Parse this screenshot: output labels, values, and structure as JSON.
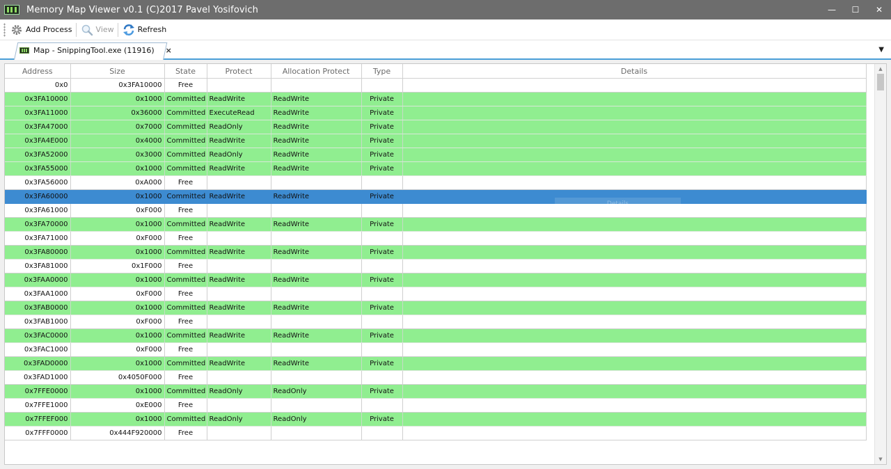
{
  "window": {
    "title": "Memory Map Viewer v0.1 (C)2017 Pavel Yosifovich",
    "minimize": "—",
    "maximize": "☐",
    "close": "✕"
  },
  "toolbar": {
    "add_process": "Add Process",
    "view": "View",
    "refresh": "Refresh"
  },
  "tab": {
    "label": "Map - SnippingTool.exe (11916)",
    "close": "×",
    "dropdown": "▼"
  },
  "grid": {
    "columns": [
      "Address",
      "Size",
      "State",
      "Protect",
      "Allocation Protect",
      "Type",
      "Details"
    ],
    "selected_details_ghost": "Details",
    "rows": [
      {
        "address": "0x0",
        "size": "0x3FA10000",
        "state": "Free",
        "protect": "",
        "alloc": "",
        "type": ""
      },
      {
        "address": "0x3FA10000",
        "size": "0x1000",
        "state": "Committed",
        "protect": "ReadWrite",
        "alloc": "ReadWrite",
        "type": "Private"
      },
      {
        "address": "0x3FA11000",
        "size": "0x36000",
        "state": "Committed",
        "protect": "ExecuteRead",
        "alloc": "ReadWrite",
        "type": "Private"
      },
      {
        "address": "0x3FA47000",
        "size": "0x7000",
        "state": "Committed",
        "protect": "ReadOnly",
        "alloc": "ReadWrite",
        "type": "Private"
      },
      {
        "address": "0x3FA4E000",
        "size": "0x4000",
        "state": "Committed",
        "protect": "ReadWrite",
        "alloc": "ReadWrite",
        "type": "Private"
      },
      {
        "address": "0x3FA52000",
        "size": "0x3000",
        "state": "Committed",
        "protect": "ReadOnly",
        "alloc": "ReadWrite",
        "type": "Private"
      },
      {
        "address": "0x3FA55000",
        "size": "0x1000",
        "state": "Committed",
        "protect": "ReadWrite",
        "alloc": "ReadWrite",
        "type": "Private"
      },
      {
        "address": "0x3FA56000",
        "size": "0xA000",
        "state": "Free",
        "protect": "",
        "alloc": "",
        "type": ""
      },
      {
        "address": "0x3FA60000",
        "size": "0x1000",
        "state": "Committed",
        "protect": "ReadWrite",
        "alloc": "ReadWrite",
        "type": "Private",
        "selected": true
      },
      {
        "address": "0x3FA61000",
        "size": "0xF000",
        "state": "Free",
        "protect": "",
        "alloc": "",
        "type": ""
      },
      {
        "address": "0x3FA70000",
        "size": "0x1000",
        "state": "Committed",
        "protect": "ReadWrite",
        "alloc": "ReadWrite",
        "type": "Private"
      },
      {
        "address": "0x3FA71000",
        "size": "0xF000",
        "state": "Free",
        "protect": "",
        "alloc": "",
        "type": ""
      },
      {
        "address": "0x3FA80000",
        "size": "0x1000",
        "state": "Committed",
        "protect": "ReadWrite",
        "alloc": "ReadWrite",
        "type": "Private"
      },
      {
        "address": "0x3FA81000",
        "size": "0x1F000",
        "state": "Free",
        "protect": "",
        "alloc": "",
        "type": ""
      },
      {
        "address": "0x3FAA0000",
        "size": "0x1000",
        "state": "Committed",
        "protect": "ReadWrite",
        "alloc": "ReadWrite",
        "type": "Private"
      },
      {
        "address": "0x3FAA1000",
        "size": "0xF000",
        "state": "Free",
        "protect": "",
        "alloc": "",
        "type": ""
      },
      {
        "address": "0x3FAB0000",
        "size": "0x1000",
        "state": "Committed",
        "protect": "ReadWrite",
        "alloc": "ReadWrite",
        "type": "Private"
      },
      {
        "address": "0x3FAB1000",
        "size": "0xF000",
        "state": "Free",
        "protect": "",
        "alloc": "",
        "type": ""
      },
      {
        "address": "0x3FAC0000",
        "size": "0x1000",
        "state": "Committed",
        "protect": "ReadWrite",
        "alloc": "ReadWrite",
        "type": "Private"
      },
      {
        "address": "0x3FAC1000",
        "size": "0xF000",
        "state": "Free",
        "protect": "",
        "alloc": "",
        "type": ""
      },
      {
        "address": "0x3FAD0000",
        "size": "0x1000",
        "state": "Committed",
        "protect": "ReadWrite",
        "alloc": "ReadWrite",
        "type": "Private"
      },
      {
        "address": "0x3FAD1000",
        "size": "0x4050F000",
        "state": "Free",
        "protect": "",
        "alloc": "",
        "type": ""
      },
      {
        "address": "0x7FFE0000",
        "size": "0x1000",
        "state": "Committed",
        "protect": "ReadOnly",
        "alloc": "ReadOnly",
        "type": "Private"
      },
      {
        "address": "0x7FFE1000",
        "size": "0xE000",
        "state": "Free",
        "protect": "",
        "alloc": "",
        "type": ""
      },
      {
        "address": "0x7FFEF000",
        "size": "0x1000",
        "state": "Committed",
        "protect": "ReadOnly",
        "alloc": "ReadOnly",
        "type": "Private"
      },
      {
        "address": "0x7FFF0000",
        "size": "0x444F920000",
        "state": "Free",
        "protect": "",
        "alloc": "",
        "type": ""
      }
    ]
  },
  "colors": {
    "titlebar": "#6d6d6d",
    "committed_row": "#90ee90",
    "free_row": "#ffffff",
    "selected_row": "#3d8bd1",
    "tab_accent": "#4a9fd8"
  },
  "icons": {
    "app": "memory-chip-icon",
    "add_process": "gear-icon",
    "view": "magnifier-icon",
    "refresh": "refresh-arrows-icon",
    "scroll_up": "scroll-up-arrow-icon",
    "scroll_down": "scroll-down-arrow-icon"
  }
}
